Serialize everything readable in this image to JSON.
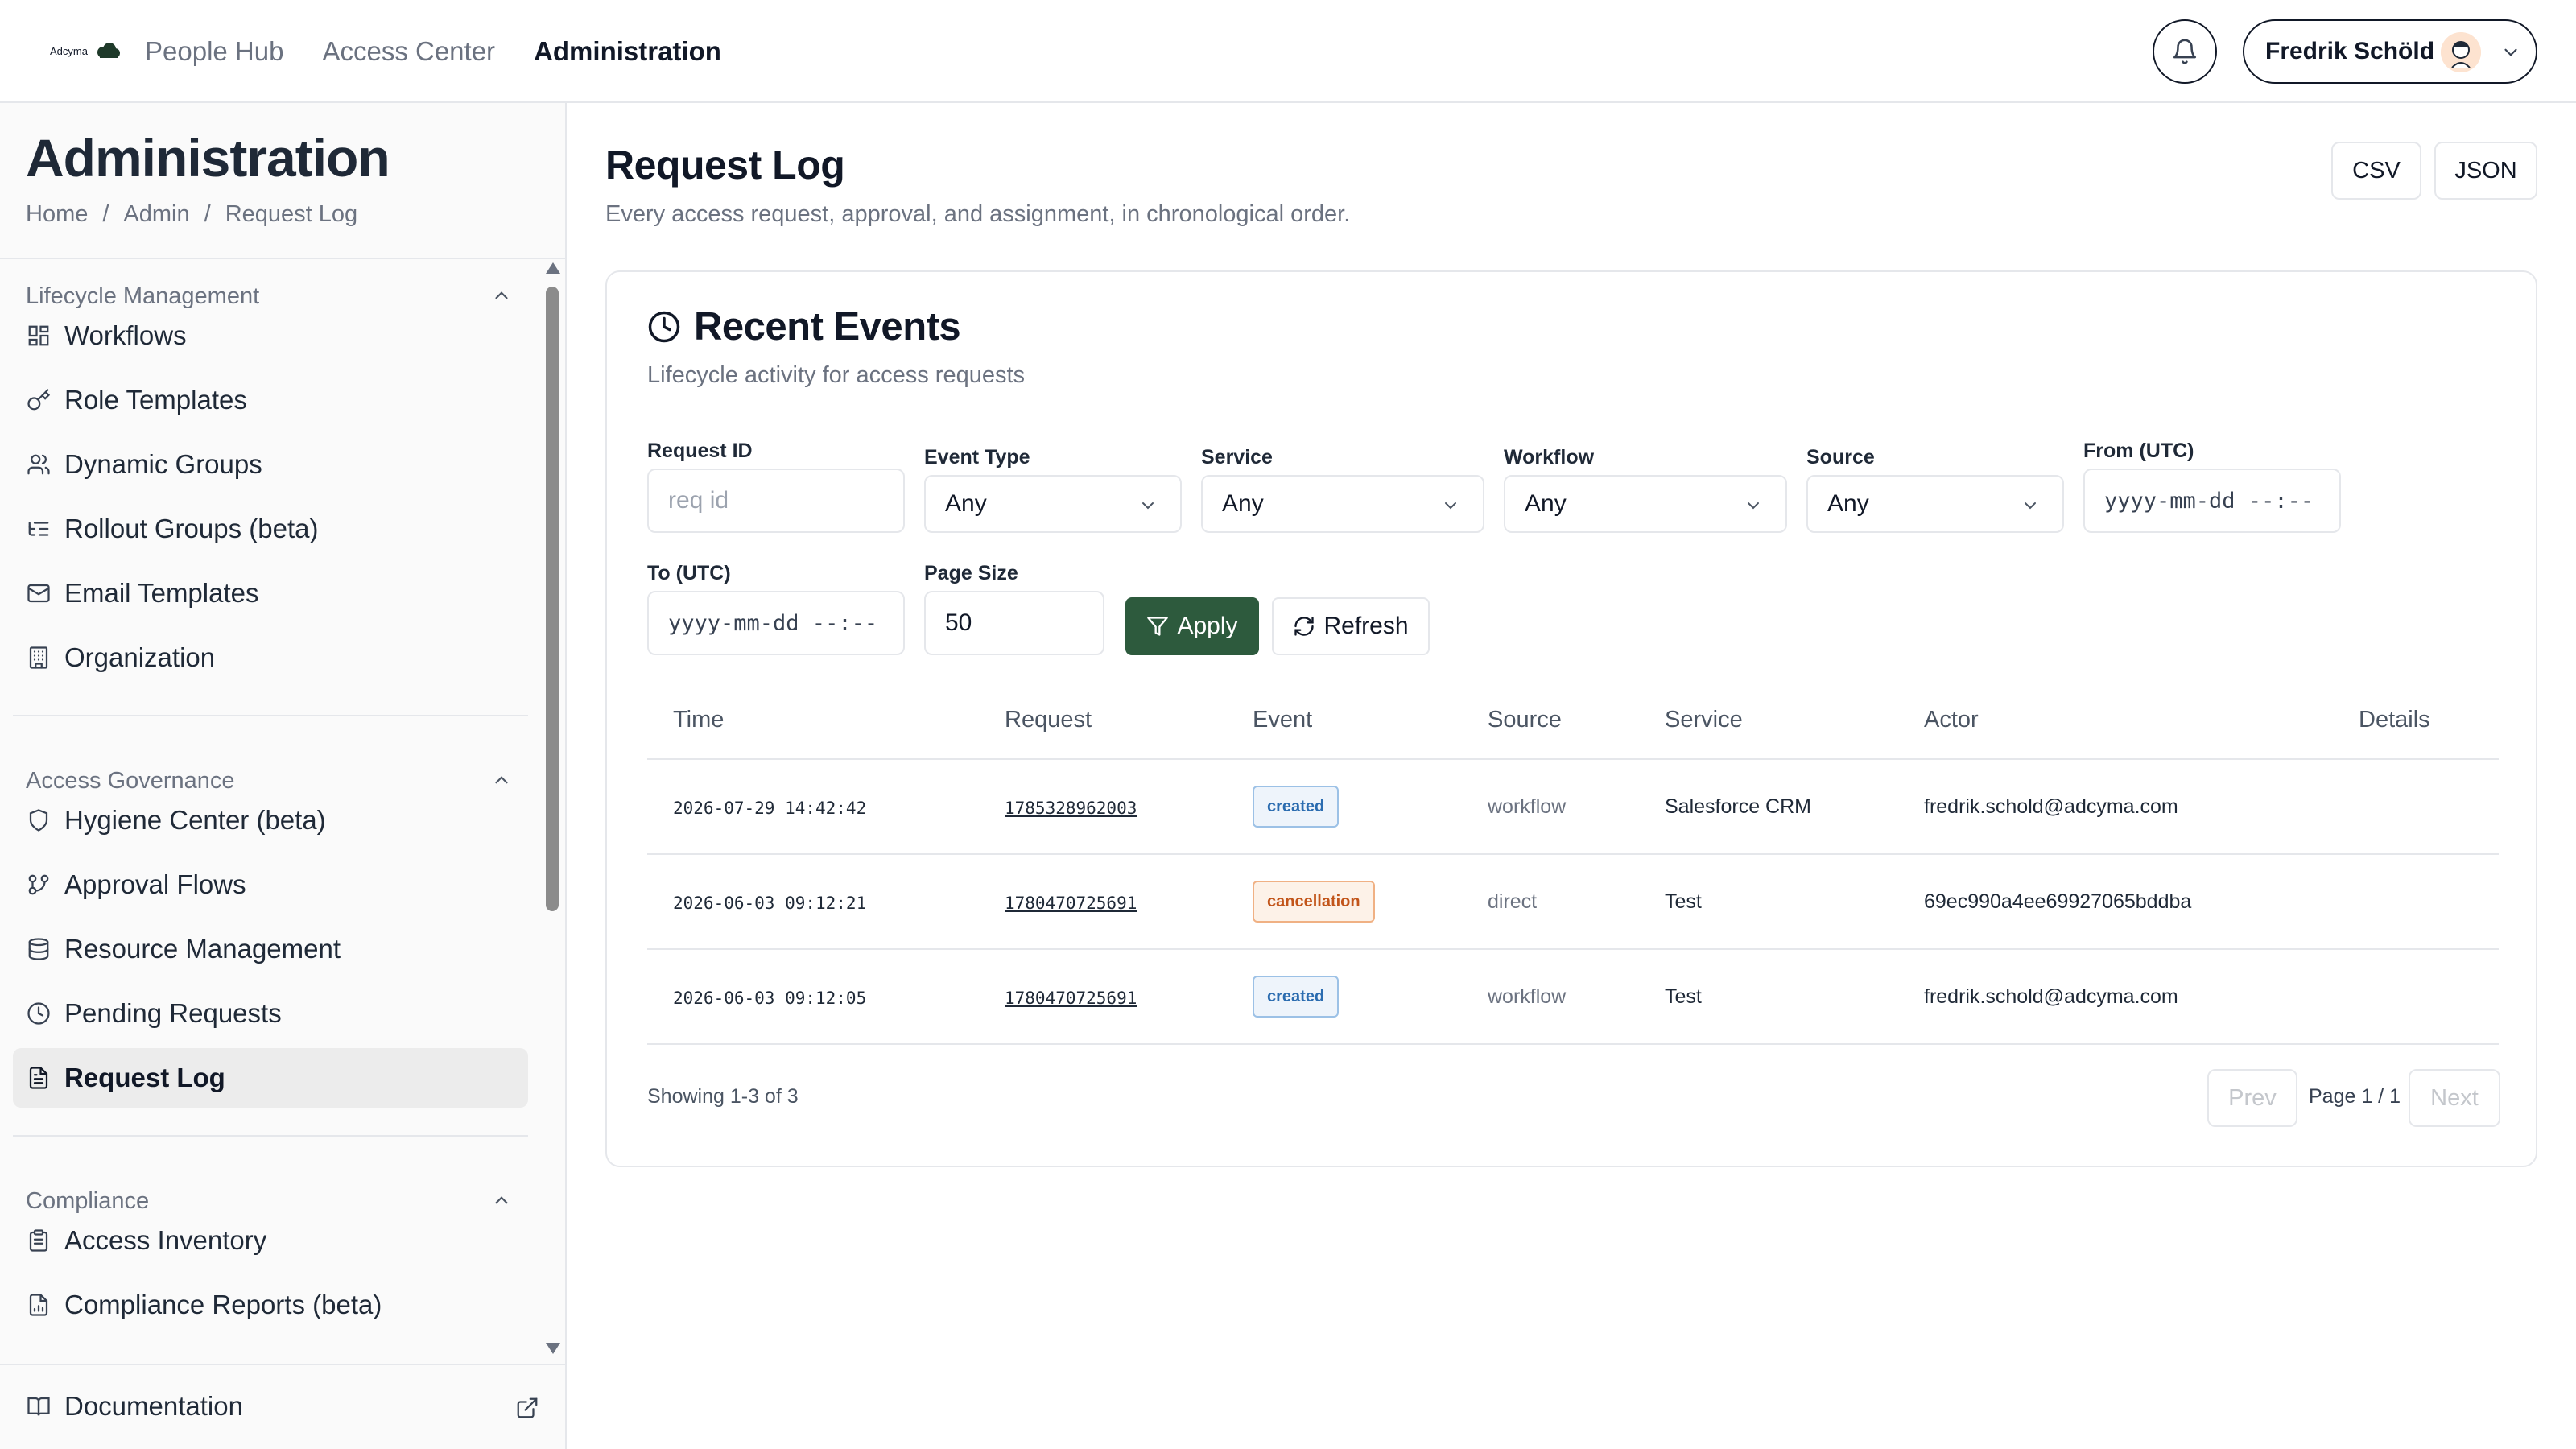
{
  "header": {
    "logo_text": "Adcyma",
    "nav": [
      {
        "label": "People Hub"
      },
      {
        "label": "Access Center"
      },
      {
        "label": "Administration"
      }
    ],
    "active_nav": "Administration",
    "user_name": "Fredrik Schöld"
  },
  "sidebar": {
    "title": "Administration",
    "breadcrumb": [
      "Home",
      "/",
      "Admin",
      "/",
      "Request Log"
    ],
    "sections": [
      {
        "title": "Lifecycle Management",
        "items": [
          {
            "label": "Workflows",
            "icon": "grid-icon"
          },
          {
            "label": "Role Templates",
            "icon": "key-icon"
          },
          {
            "label": "Dynamic Groups",
            "icon": "users-icon"
          },
          {
            "label": "Rollout Groups (beta)",
            "icon": "list-tree-icon"
          },
          {
            "label": "Email Templates",
            "icon": "mail-icon"
          },
          {
            "label": "Organization",
            "icon": "building-icon"
          }
        ]
      },
      {
        "title": "Access Governance",
        "items": [
          {
            "label": "Hygiene Center (beta)",
            "icon": "shield-icon"
          },
          {
            "label": "Approval Flows",
            "icon": "git-branch-icon"
          },
          {
            "label": "Resource Management",
            "icon": "database-icon"
          },
          {
            "label": "Pending Requests",
            "icon": "clock-icon"
          },
          {
            "label": "Request Log",
            "icon": "file-text-icon"
          }
        ]
      },
      {
        "title": "Compliance",
        "items": [
          {
            "label": "Access Inventory",
            "icon": "clipboard-icon"
          },
          {
            "label": "Compliance Reports (beta)",
            "icon": "file-chart-icon"
          }
        ]
      }
    ],
    "active_item": "Request Log",
    "footer": {
      "label": "Documentation",
      "icon": "book-icon"
    }
  },
  "main": {
    "title": "Request Log",
    "subtitle": "Every access request, approval, and assignment, in chronological order.",
    "export_buttons": [
      "CSV",
      "JSON"
    ],
    "card": {
      "title": "Recent Events",
      "subtitle": "Lifecycle activity for access requests"
    },
    "filters": {
      "request_id": {
        "label": "Request ID",
        "placeholder": "req id"
      },
      "event_type": {
        "label": "Event Type",
        "value": "Any"
      },
      "service": {
        "label": "Service",
        "value": "Any"
      },
      "workflow": {
        "label": "Workflow",
        "value": "Any"
      },
      "source": {
        "label": "Source",
        "value": "Any"
      },
      "from": {
        "label": "From (UTC)",
        "placeholder": "yyyy-mm-dd --:--"
      },
      "to": {
        "label": "To (UTC)",
        "placeholder": "yyyy-mm-dd --:--"
      },
      "page_size": {
        "label": "Page Size",
        "value": "50"
      },
      "apply_label": "Apply",
      "refresh_label": "Refresh"
    },
    "table": {
      "columns": [
        "Time",
        "Request",
        "Event",
        "Source",
        "Service",
        "Actor",
        "Details"
      ],
      "rows": [
        {
          "time": "2026-07-29 14:42:42",
          "request": "1785328962003",
          "event": "created",
          "source": "workflow",
          "service": "Salesforce CRM",
          "actor": "fredrik.schold@adcyma.com",
          "details": ""
        },
        {
          "time": "2026-06-03 09:12:21",
          "request": "1780470725691",
          "event": "cancellation",
          "source": "direct",
          "service": "Test",
          "actor": "69ec990a4ee69927065bddba",
          "details": ""
        },
        {
          "time": "2026-06-03 09:12:05",
          "request": "1780470725691",
          "event": "created",
          "source": "workflow",
          "service": "Test",
          "actor": "fredrik.schold@adcyma.com",
          "details": ""
        }
      ]
    },
    "pagination": {
      "showing": "Showing 1-3 of 3",
      "prev": "Prev",
      "page": "Page 1 / 1",
      "next": "Next"
    }
  },
  "colors": {
    "accent": "#2d5a3d",
    "badge_created": "#2b6cb0",
    "badge_cancellation": "#c2551a"
  }
}
